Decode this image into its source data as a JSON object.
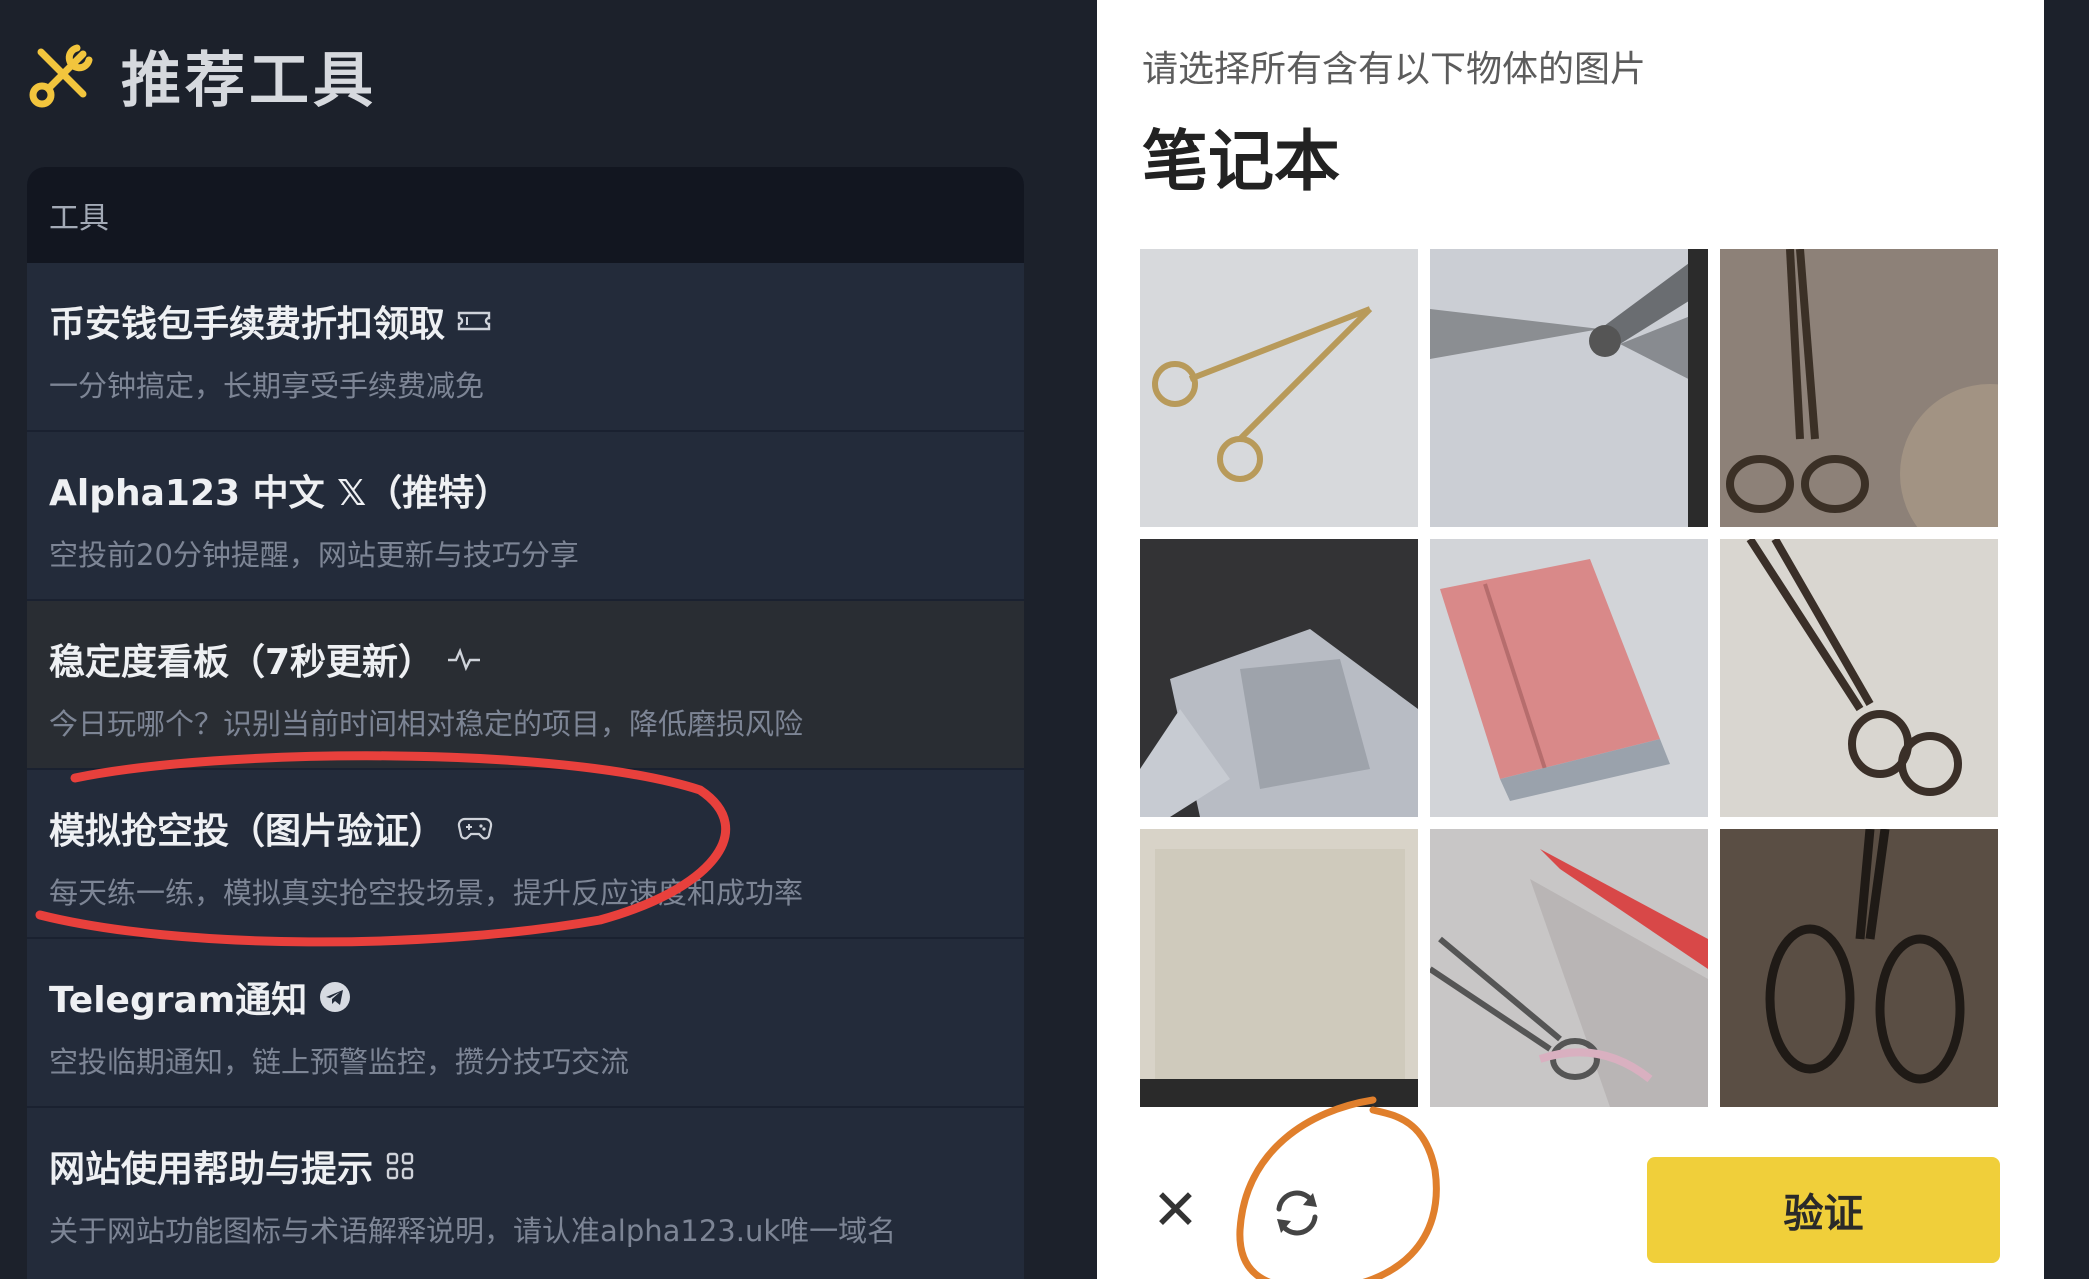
{
  "header": {
    "title": "推荐工具",
    "icon": "tools-icon"
  },
  "tools": {
    "header_label": "工具",
    "items": [
      {
        "title": "币安钱包手续费折扣领取",
        "subtitle": "一分钟搞定，长期享受手续费减免",
        "icon": "ticket-icon"
      },
      {
        "title": "Alpha123 中文 𝕏（推特）",
        "subtitle": "空投前20分钟提醒，网站更新与技巧分享",
        "icon": ""
      },
      {
        "title": "稳定度看板（7秒更新）",
        "subtitle": "今日玩哪个？识别当前时间相对稳定的项目，降低磨损风险",
        "icon": "pulse-icon"
      },
      {
        "title": "模拟抢空投（图片验证）",
        "subtitle": "每天练一练，模拟真实抢空投场景，提升反应速度和成功率",
        "icon": "gamepad-icon"
      },
      {
        "title": "Telegram通知",
        "subtitle": "空投临期通知，链上预警监控，攒分技巧交流",
        "icon": "telegram-icon"
      },
      {
        "title": "网站使用帮助与提示",
        "subtitle": "关于网站功能图标与术语解释说明，请认准alpha123.uk唯一域名",
        "icon": "grid-icon"
      }
    ]
  },
  "captcha": {
    "prompt": "请选择所有含有以下物体的图片",
    "target": "笔记本",
    "tiles": [
      "scissors",
      "scissors",
      "scissors",
      "notebook",
      "notebook",
      "scissors",
      "notebook",
      "scissors",
      "scissors"
    ],
    "close_icon": "close-icon",
    "refresh_icon": "refresh-icon",
    "verify_label": "验证"
  },
  "colors": {
    "accent_yellow": "#f0cf3a",
    "annotation_red": "#e8403c",
    "annotation_orange": "#e07f2c"
  }
}
